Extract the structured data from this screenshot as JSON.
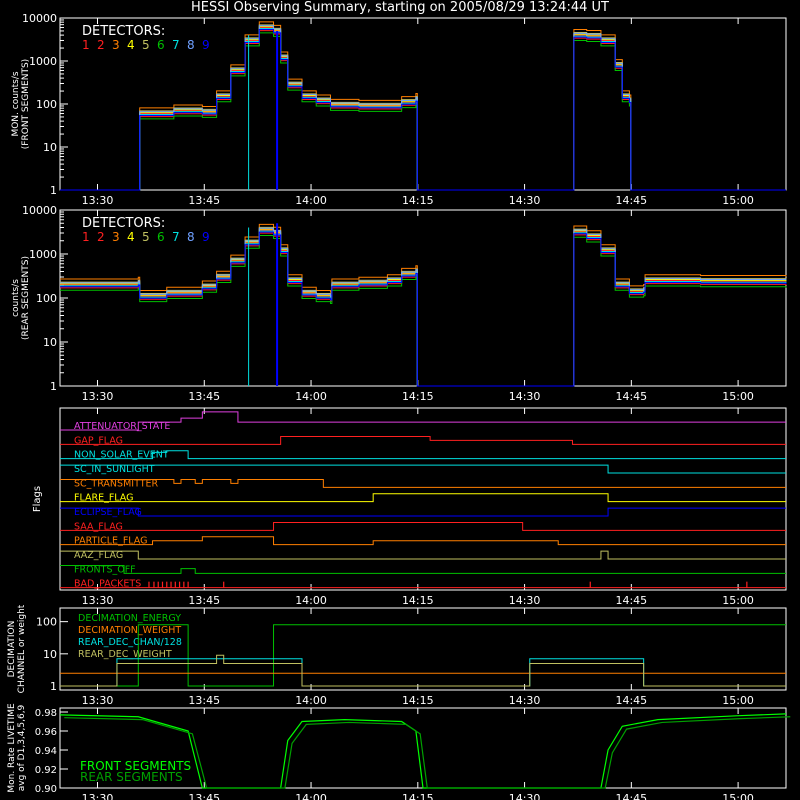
{
  "title": "HESSI Observing Summary, starting on 2005/08/29 13:24:44 UT",
  "time_ticks": [
    "13:30",
    "13:45",
    "14:00",
    "14:15",
    "14:30",
    "14:45",
    "15:00"
  ],
  "time_tick_values_min": [
    5.27,
    20.27,
    35.27,
    50.27,
    65.27,
    80.27,
    95.27
  ],
  "colors": {
    "background": "#000000",
    "axes": "#ffffff",
    "detectors": [
      "#ff2020",
      "#ff2020",
      "#ff7f00",
      "#ffff00",
      "#bfbf60",
      "#00c000",
      "#00e0e0",
      "#6fa0ff",
      "#0000ff"
    ]
  },
  "chart_data": [
    {
      "type": "line",
      "name": "front",
      "ylabel": [
        "MON. counts/s",
        "(FRONT SEGMENTS)"
      ],
      "yscale": "log",
      "ylim": [
        1,
        10000
      ],
      "ytick_labels": [
        "1",
        "10",
        "100",
        "1000",
        "10000"
      ],
      "legend_title": "DETECTORS:",
      "legend_items": [
        "1",
        "2",
        "3",
        "4",
        "5",
        "6",
        "7",
        "8",
        "9"
      ],
      "series": [
        {
          "name": "detector",
          "values": [
            [
              0,
              1
            ],
            [
              11,
              1
            ],
            [
              11.2,
              60
            ],
            [
              16,
              70
            ],
            [
              20,
              65
            ],
            [
              22,
              150
            ],
            [
              24,
              600
            ],
            [
              26,
              3000
            ],
            [
              28,
              6000
            ],
            [
              30,
              5000
            ],
            [
              31,
              1200
            ],
            [
              32,
              280
            ],
            [
              34,
              150
            ],
            [
              36,
              120
            ],
            [
              38,
              95
            ],
            [
              42,
              90
            ],
            [
              46,
              90
            ],
            [
              48,
              110
            ],
            [
              50,
              130
            ],
            [
              50.2,
              1
            ],
            [
              72,
              1
            ],
            [
              72.2,
              4000
            ],
            [
              74,
              3800
            ],
            [
              76,
              3000
            ],
            [
              78,
              800
            ],
            [
              79,
              150
            ],
            [
              80,
              120
            ],
            [
              80.2,
              1
            ],
            [
              102,
              1
            ]
          ]
        }
      ]
    },
    {
      "type": "line",
      "name": "rear",
      "ylabel": [
        "counts/s",
        "(REAR SEGMENTS)"
      ],
      "yscale": "log",
      "ylim": [
        1,
        10000
      ],
      "ytick_labels": [
        "1",
        "10",
        "100",
        "1000",
        "10000"
      ],
      "legend_title": "DETECTORS:",
      "legend_items": [
        "1",
        "2",
        "3",
        "4",
        "5",
        "6",
        "7",
        "8",
        "9"
      ],
      "series": [
        {
          "name": "detector",
          "values": [
            [
              0,
              200
            ],
            [
              11,
              220
            ],
            [
              11.2,
              110
            ],
            [
              15,
              130
            ],
            [
              20,
              180
            ],
            [
              22,
              300
            ],
            [
              24,
              700
            ],
            [
              26,
              1800
            ],
            [
              28,
              3500
            ],
            [
              30,
              3000
            ],
            [
              31,
              1200
            ],
            [
              32,
              250
            ],
            [
              34,
              130
            ],
            [
              36,
              110
            ],
            [
              38,
              100
            ],
            [
              38.2,
              200
            ],
            [
              42,
              220
            ],
            [
              46,
              250
            ],
            [
              48,
              350
            ],
            [
              50,
              400
            ],
            [
              50.2,
              1
            ],
            [
              72,
              1
            ],
            [
              72.2,
              3200
            ],
            [
              74,
              2500
            ],
            [
              76,
              1200
            ],
            [
              78,
              200
            ],
            [
              80,
              140
            ],
            [
              82,
              150
            ],
            [
              82.2,
              250
            ],
            [
              90,
              240
            ],
            [
              102,
              230
            ]
          ]
        }
      ]
    }
  ],
  "flags_panel": {
    "ylabel": "Flags",
    "items": [
      {
        "label": "ATTENUATOR_STATE",
        "color": "#e040e0"
      },
      {
        "label": "GAP_FLAG",
        "color": "#ff2020"
      },
      {
        "label": "NON_SOLAR_EVENT",
        "color": "#00e0e0"
      },
      {
        "label": "SC_IN_SUNLIGHT",
        "color": "#00e0e0"
      },
      {
        "label": "SC_TRANSMITTER",
        "color": "#ff7f00"
      },
      {
        "label": "FLARE_FLAG",
        "color": "#ffff00"
      },
      {
        "label": "ECLIPSE_FLAG",
        "color": "#0000ff"
      },
      {
        "label": "SAA_FLAG",
        "color": "#ff2020"
      },
      {
        "label": "PARTICLE_FLAG",
        "color": "#ff7f00"
      },
      {
        "label": "AAZ_FLAG",
        "color": "#bfbf60"
      },
      {
        "label": "FRONTS_OFF",
        "color": "#00c000"
      },
      {
        "label": "BAD_PACKETS",
        "color": "#ff2020"
      }
    ]
  },
  "decimation_panel": {
    "ylabel": [
      "DECIMATION",
      "CHANNEL or weight"
    ],
    "ytick_labels": [
      "1",
      "10",
      "100"
    ],
    "items": [
      {
        "label": "DECIMATION_ENERGY",
        "color": "#00c000"
      },
      {
        "label": "DECIMATION_WEIGHT",
        "color": "#ff7f00"
      },
      {
        "label": "REAR_DEC_CHAN/128",
        "color": "#00e0e0"
      },
      {
        "label": "REAR_DEC_WEIGHT",
        "color": "#bfbf60"
      }
    ]
  },
  "livetime_panel": {
    "ylabel": [
      "Mon. Rate LIVETIME",
      "avg of D1,3,4,5,6,9"
    ],
    "ylim": [
      0.9,
      0.98
    ],
    "ytick_labels": [
      "0.90",
      "0.92",
      "0.94",
      "0.96",
      "0.98"
    ],
    "items": [
      {
        "label": "FRONT SEGMENTS",
        "color": "#00ff00"
      },
      {
        "label": "REAR  SEGMENTS",
        "color": "#00a000"
      }
    ]
  }
}
